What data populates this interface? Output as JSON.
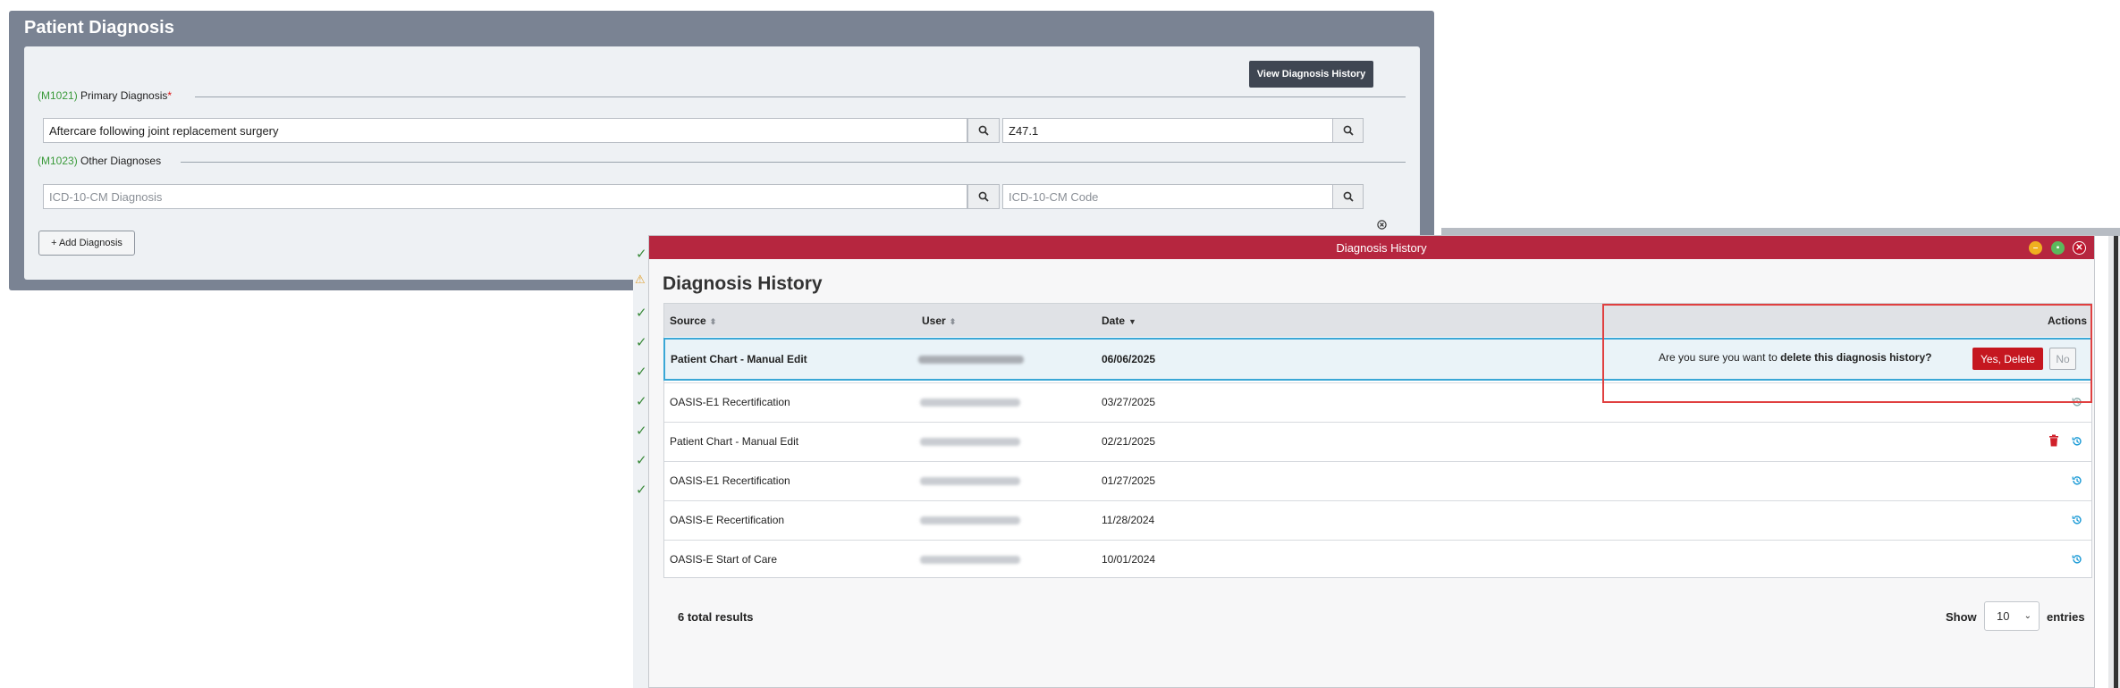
{
  "patient_diagnosis": {
    "title": "Patient Diagnosis",
    "view_history_label": "View Diagnosis History",
    "primary": {
      "code": "(M1021)",
      "label": "Primary Diagnosis",
      "required_mark": "*",
      "diagnosis_value": "Aftercare following joint replacement surgery",
      "code_value": "Z47.1"
    },
    "other": {
      "code": "(M1023)",
      "label": "Other Diagnoses",
      "diagnosis_placeholder": "ICD-10-CM Diagnosis",
      "code_placeholder": "ICD-10-CM Code"
    },
    "add_label": "+ Add Diagnosis",
    "icons": {
      "search": "search-icon",
      "close": "close-circle-icon"
    }
  },
  "dialog": {
    "window_title": "Diagnosis History",
    "heading": "Diagnosis History",
    "columns": {
      "source": "Source",
      "user": "User",
      "date": "Date",
      "actions": "Actions"
    },
    "rows": [
      {
        "source": "Patient Chart - Manual Edit",
        "date": "06/06/2025"
      },
      {
        "source": "OASIS-E1 Recertification",
        "date": "03/27/2025"
      },
      {
        "source": "Patient Chart - Manual Edit",
        "date": "02/21/2025"
      },
      {
        "source": "OASIS-E1 Recertification",
        "date": "01/27/2025"
      },
      {
        "source": "OASIS-E Recertification",
        "date": "11/28/2024"
      },
      {
        "source": "OASIS-E Start of Care",
        "date": "10/01/2024"
      }
    ],
    "confirm": {
      "prefix": "Are you sure you want to ",
      "emphasis": "delete this diagnosis history?",
      "yes_label": "Yes, Delete",
      "no_label": "No"
    },
    "footer": {
      "total": "6 total results",
      "show": "Show",
      "entries_value": "10",
      "entries": "entries"
    },
    "colors": {
      "titlebar": "#b6263f",
      "delete": "#c51720",
      "highlight_border": "#3aa7d6",
      "callout": "#e04040"
    }
  }
}
